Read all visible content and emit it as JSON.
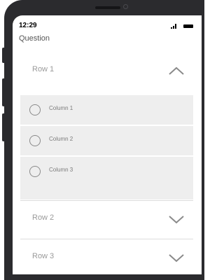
{
  "status_bar": {
    "time": "12:29"
  },
  "question": {
    "label": "Question"
  },
  "accordion": {
    "rows": [
      {
        "label": "Row 1",
        "expanded": true
      },
      {
        "label": "Row 2",
        "expanded": false
      },
      {
        "label": "Row 3",
        "expanded": false
      }
    ],
    "options": [
      {
        "label": "Column 1"
      },
      {
        "label": "Column 2"
      },
      {
        "label": "Column 3"
      }
    ]
  },
  "colors": {
    "option_background": "#eeeeee",
    "bezel": "#2b2b2e",
    "label_gray": "#9a9a9a"
  },
  "icons": [
    "chevron-up-icon",
    "chevron-down-icon",
    "radio-unchecked-icon",
    "signal-icon",
    "battery-icon"
  ]
}
